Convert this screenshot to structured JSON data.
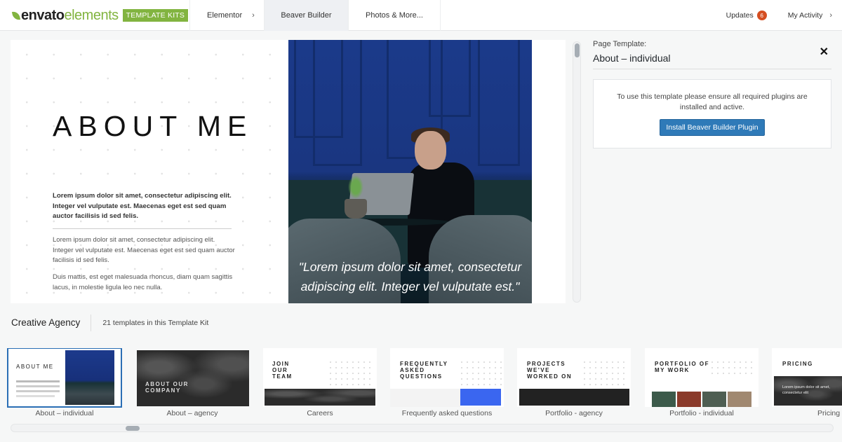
{
  "header": {
    "logo": {
      "brand": "envato",
      "product": "elements",
      "badge": "TEMPLATE KITS",
      "brand_color": "#82b440"
    },
    "nav": [
      {
        "label": "Elementor",
        "has_chevron": true,
        "active": false
      },
      {
        "label": "Beaver Builder",
        "has_chevron": false,
        "active": true
      },
      {
        "label": "Photos & More...",
        "has_chevron": false,
        "active": false
      }
    ],
    "updates": {
      "label": "Updates",
      "count": "6",
      "badge_color": "#d54e21"
    },
    "my_activity": {
      "label": "My Activity"
    }
  },
  "preview": {
    "title": "ABOUT ME",
    "bold_paragraph": "Lorem ipsum dolor sit amet, consectetur adipiscing elit. Integer vel vulputate est. Maecenas eget est sed quam auctor facilisis id sed felis.",
    "paragraph_1": "Lorem ipsum dolor sit amet, consectetur adipiscing elit. Integer vel vulputate est. Maecenas eget est sed quam auctor facilisis id sed felis.",
    "paragraph_2": "Duis mattis, est eget malesuada rhoncus, diam quam sagittis lacus, in molestie ligula leo nec nulla.",
    "quote": "\"Lorem ipsum dolor sit amet, consectetur adipiscing elit. Integer vel vulputate est.\""
  },
  "sidebar": {
    "label": "Page Template:",
    "title": "About – individual",
    "close_icon": "close-icon",
    "notice": "To use this template please ensure all required plugins are installed and active.",
    "install_button": "Install Beaver Builder Plugin",
    "button_color": "#2f7ab8"
  },
  "kit": {
    "name": "Creative Agency",
    "count_text": "21 templates in this Template Kit"
  },
  "templates": [
    {
      "label": "About – individual",
      "heading": "ABOUT ME",
      "selected": true
    },
    {
      "label": "About – agency",
      "heading": "ABOUT OUR COMPANY",
      "selected": false
    },
    {
      "label": "Careers",
      "heading": "JOIN OUR TEAM",
      "selected": false
    },
    {
      "label": "Frequently asked questions",
      "heading": "FREQUENTLY ASKED QUESTIONS",
      "selected": false
    },
    {
      "label": "Portfolio - agency",
      "heading": "PROJECTS WE'VE WORKED ON",
      "selected": false
    },
    {
      "label": "Portfolio - individual",
      "heading": "PORTFOLIO OF MY WORK",
      "selected": false
    },
    {
      "label": "Pricing",
      "heading": "PRICING",
      "selected": false
    }
  ],
  "thumb_text": {
    "pricing_body": "Lorem ipsum dolor sit amet, consectetur elit"
  }
}
